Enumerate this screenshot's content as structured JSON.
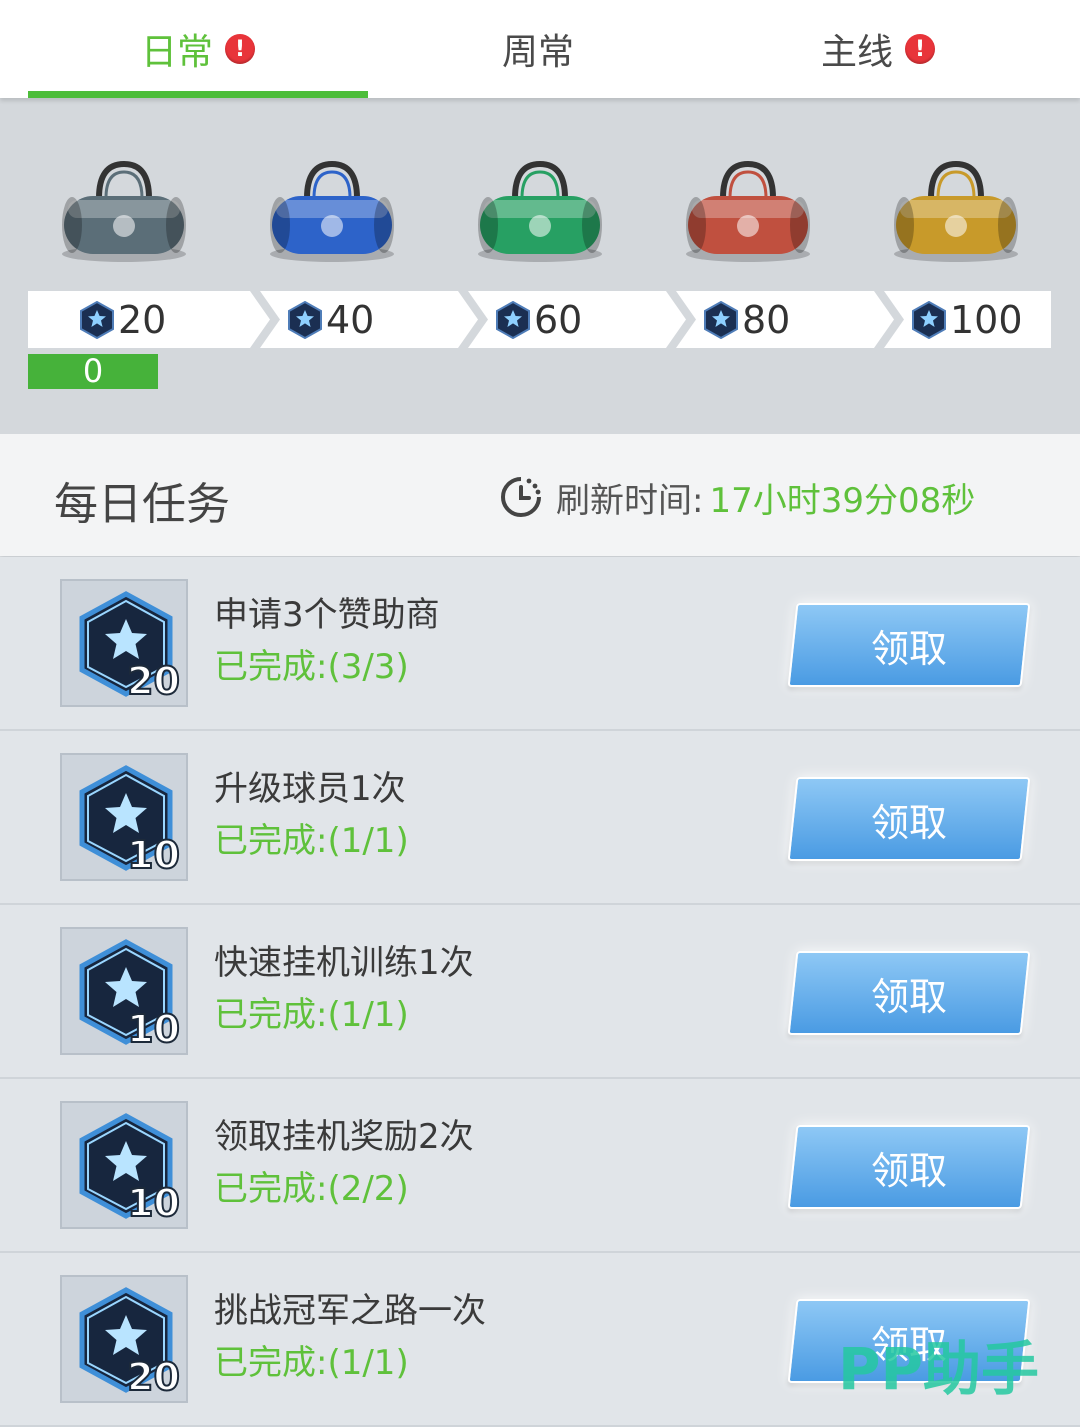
{
  "tabs": [
    {
      "label": "日常",
      "alert": "!",
      "active": true
    },
    {
      "label": "周常",
      "alert": "",
      "active": false
    },
    {
      "label": "主线",
      "alert": "!",
      "active": false
    }
  ],
  "rewards": {
    "bags": [
      {
        "name": "gray-bag",
        "color": "#5b6e78",
        "value": "20"
      },
      {
        "name": "blue-bag",
        "color": "#2d63c9",
        "value": "40"
      },
      {
        "name": "green-bag",
        "color": "#27a063",
        "value": "60"
      },
      {
        "name": "red-bag",
        "color": "#c0503f",
        "value": "80"
      },
      {
        "name": "gold-bag",
        "color": "#c89a2a",
        "value": "100"
      }
    ],
    "current_points": "0",
    "progress_fraction": 0
  },
  "section": {
    "title": "每日任务",
    "refresh_label": "刷新时间:",
    "refresh_time": "17小时39分08秒"
  },
  "tasks": [
    {
      "title": "申请3个赞助商",
      "progress": "已完成:(3/3)",
      "points": "20",
      "button": "领取"
    },
    {
      "title": "升级球员1次",
      "progress": "已完成:(1/1)",
      "points": "10",
      "button": "领取"
    },
    {
      "title": "快速挂机训练1次",
      "progress": "已完成:(1/1)",
      "points": "10",
      "button": "领取"
    },
    {
      "title": "领取挂机奖励2次",
      "progress": "已完成:(2/2)",
      "points": "10",
      "button": "领取"
    },
    {
      "title": "挑战冠军之路一次",
      "progress": "已完成:(1/1)",
      "points": "20",
      "button": "领取"
    }
  ],
  "watermark": "PP助手",
  "colors": {
    "accent_green": "#5fc13b",
    "alert_red": "#e8343a",
    "button_blue": "#4a9be3"
  }
}
